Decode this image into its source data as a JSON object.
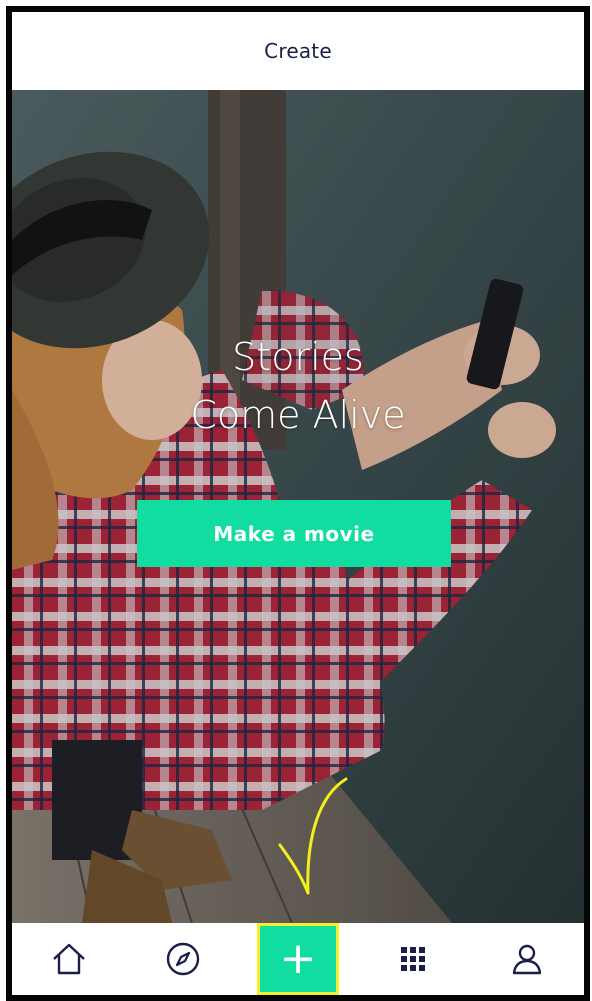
{
  "header": {
    "title": "Create"
  },
  "hero": {
    "tagline_line1": "Stories",
    "tagline_line2": "Come Alive",
    "cta_label": "Make a movie",
    "background": "photo of woman in plaid shirt and hat taking a picture with a phone by the water"
  },
  "tabbar": {
    "items": [
      {
        "icon": "home-icon"
      },
      {
        "icon": "compass-icon"
      },
      {
        "icon": "plus-icon",
        "glyph": "+"
      },
      {
        "icon": "grid-icon"
      },
      {
        "icon": "profile-icon"
      }
    ]
  },
  "colors": {
    "accent": "#12dda0",
    "highlight_border": "#f2ef2b",
    "header_text": "#1a1f4a",
    "icon_color": "#1a1f4a"
  }
}
